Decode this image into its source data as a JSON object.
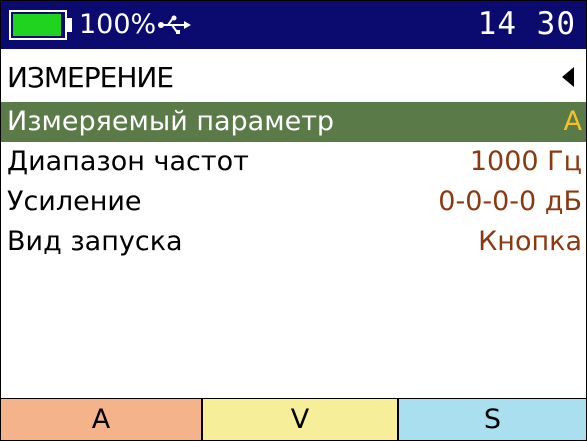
{
  "status": {
    "battery_percent_text": "100%",
    "battery_level": 0.95,
    "usb_icon": "usb-icon",
    "time": "14 30",
    "colors": {
      "bar": "#0b0b6f",
      "battery": "#1fd31f",
      "text": "#ffffff"
    }
  },
  "header": {
    "title": "ИЗМЕРЕНИЕ",
    "back_icon": "triangle-left-icon"
  },
  "menu": {
    "items": [
      {
        "label": "Измеряемый параметр",
        "value": "A",
        "selected": true
      },
      {
        "label": "Диапазон частот",
        "value": "1000 Гц",
        "selected": false
      },
      {
        "label": "Усиление",
        "value": "0-0-0-0 дБ",
        "selected": false
      },
      {
        "label": "Вид запуска",
        "value": "Кнопка",
        "selected": false
      }
    ],
    "colors": {
      "selected_bg": "#5a7a48",
      "selected_value": "#f2c12e",
      "value": "#8a3a10"
    }
  },
  "softkeys": [
    {
      "label": "A",
      "color": "#f5b38c"
    },
    {
      "label": "V",
      "color": "#f7ee9a"
    },
    {
      "label": "S",
      "color": "#a9dfee"
    }
  ]
}
